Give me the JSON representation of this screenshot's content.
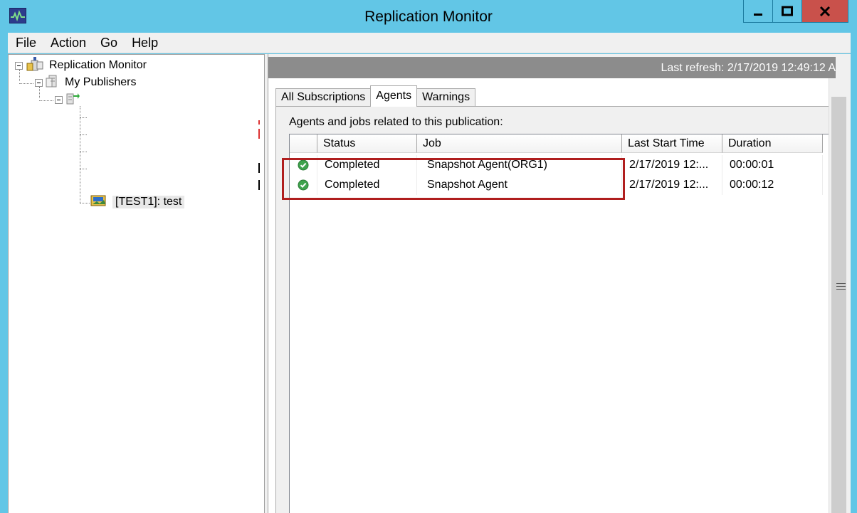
{
  "window": {
    "title": "Replication Monitor",
    "minimize_icon": "minimize-icon",
    "maximize_icon": "maximize-icon",
    "close_icon": "close-icon"
  },
  "menu": {
    "items": [
      "File",
      "Action",
      "Go",
      "Help"
    ]
  },
  "tree": {
    "root": "Replication Monitor",
    "publishers": "My Publishers",
    "publication": "[TEST1]: test"
  },
  "right": {
    "last_refresh": "Last refresh: 2/17/2019 12:49:12 A",
    "tabs": [
      "All Subscriptions",
      "Agents",
      "Warnings"
    ],
    "active_tab": "Agents",
    "caption": "Agents and jobs related to this publication:",
    "columns": [
      "",
      "Status",
      "Job",
      "Last Start Time",
      "Duration"
    ],
    "rows": [
      {
        "status_icon": "success-check-icon",
        "status": "Completed",
        "job": "Snapshot Agent(ORG1)",
        "last_start": "2/17/2019 12:...",
        "duration": "00:00:01"
      },
      {
        "status_icon": "success-check-icon",
        "status": "Completed",
        "job": "Snapshot Agent",
        "last_start": "2/17/2019 12:...",
        "duration": "00:00:12"
      }
    ]
  },
  "colors": {
    "titlebar": "#62c6e6",
    "close_button": "#c9514b",
    "highlight_border": "#b01e1e",
    "status_success": "#3fa34d"
  }
}
